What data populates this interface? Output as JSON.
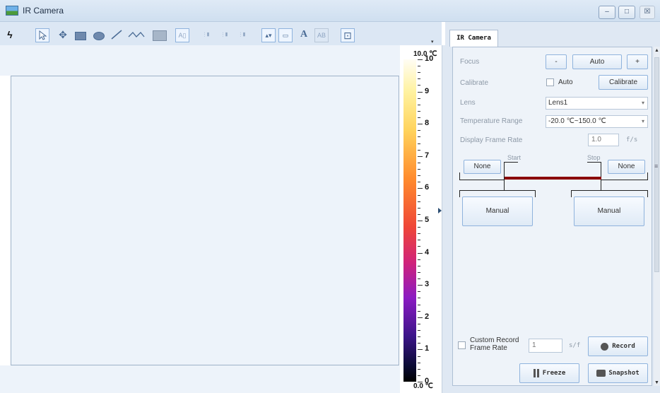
{
  "window": {
    "title": "IR Camera",
    "minimize": "–",
    "maximize": "□",
    "close": "☒"
  },
  "tab": {
    "label": "IR Camera"
  },
  "toolbar": {
    "text_tool": "A",
    "label_tool": "AB"
  },
  "scale": {
    "top_value": "10.0 ℃",
    "bottom_value": "0.0 ℃",
    "ticks": [
      "10",
      "9",
      "8",
      "7",
      "6",
      "5",
      "4",
      "3",
      "2",
      "1",
      "0"
    ]
  },
  "settings": {
    "focus_label": "Focus",
    "focus_minus": "-",
    "focus_auto": "Auto",
    "focus_plus": "+",
    "calibrate_label": "Calibrate",
    "auto_checkbox": "Auto",
    "calibrate_button": "Calibrate",
    "lens_label": "Lens",
    "lens_value": "Lens1",
    "temp_label": "Temperature Range",
    "temp_value": "-20.0 ℃~150.0 ℃",
    "frame_rate_label": "Display Frame Rate",
    "frame_rate_value": "1.0",
    "frame_rate_unit": "f/s",
    "start_label": "Start",
    "stop_label": "Stop",
    "none_left": "None",
    "none_right": "None",
    "manual_left": "Manual",
    "manual_right": "Manual",
    "custom_record_label": "Custom Record\nFrame Rate",
    "record_value": "1",
    "record_unit": "s/f",
    "record_button": "Record",
    "freeze_button": "Freeze",
    "snapshot_button": "Snapshot"
  }
}
